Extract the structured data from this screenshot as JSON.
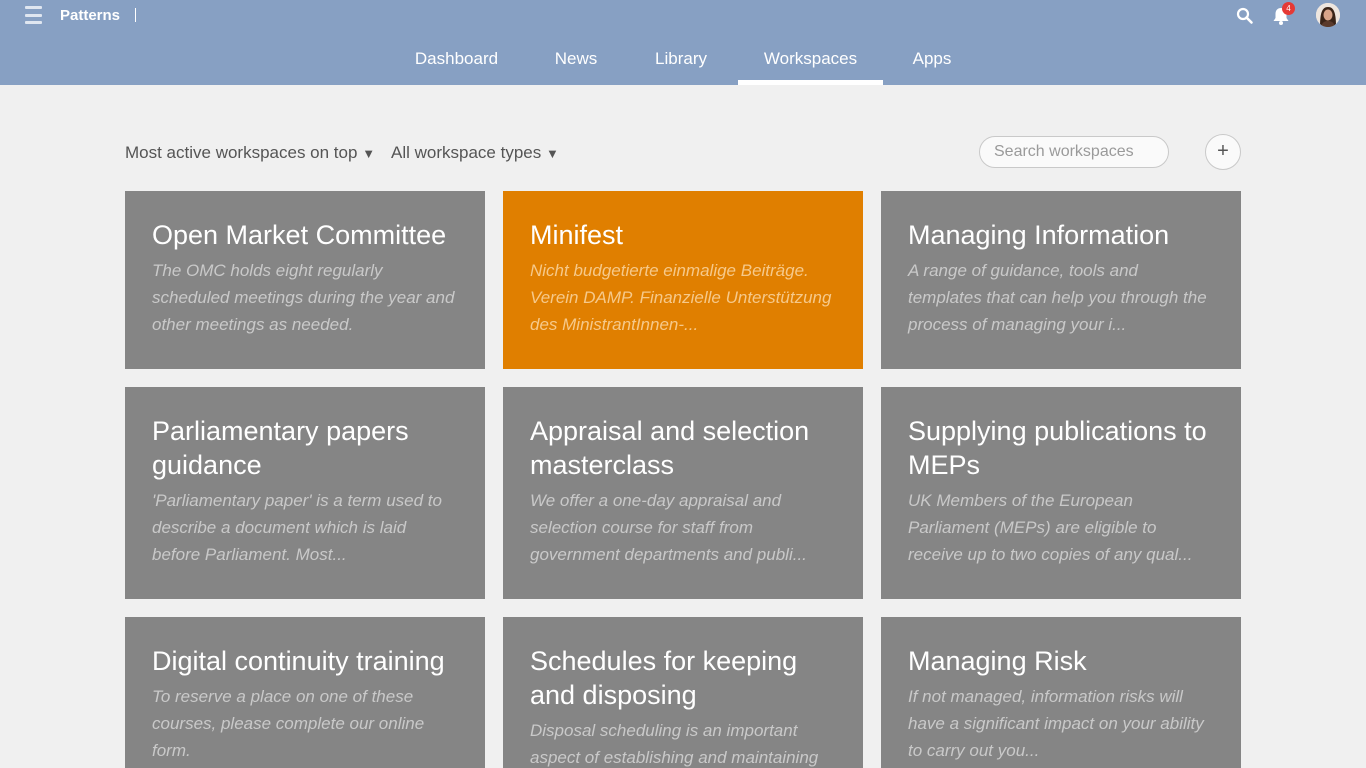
{
  "header": {
    "brand": "Patterns",
    "notification_count": "4",
    "icons": {
      "menu": "hamburger-icon",
      "search": "search-icon",
      "notifications": "bell-icon",
      "avatar": "user-avatar"
    },
    "colors": {
      "topbar": "#87a0c3",
      "badge": "#e53935"
    }
  },
  "nav": {
    "items": [
      {
        "label": "Dashboard"
      },
      {
        "label": "News"
      },
      {
        "label": "Library"
      },
      {
        "label": "Workspaces",
        "active": true
      },
      {
        "label": "Apps"
      }
    ]
  },
  "filters": {
    "sort_label": "Most active workspaces on top",
    "type_label": "All workspace types",
    "caret": "▼",
    "search_placeholder": "Search workspaces",
    "add_label": "+"
  },
  "cards": [
    {
      "title": "Open Market Committee",
      "desc": "The OMC holds eight regularly scheduled meetings during the year and other meetings as needed."
    },
    {
      "title": "Minifest",
      "desc": "Nicht budgetierte einmalige Beiträge. Verein DAMP. Finanzielle Unterstützung des MinistrantInnen-...",
      "color": "#e07f00"
    },
    {
      "title": "Managing Information",
      "desc": "A range of guidance, tools and templates that can help you through the process of managing your i..."
    },
    {
      "title": "Parliamentary papers guidance",
      "desc": "'Parliamentary paper' is a term used to describe a document which is laid before Parliament. Most..."
    },
    {
      "title": "Appraisal and selection masterclass",
      "desc": "We offer a one-day appraisal and selection course for staff from government departments and publi..."
    },
    {
      "title": "Supplying publications to MEPs",
      "desc": "UK Members of the European Parliament (MEPs) are eligible to receive up to two copies of any qual..."
    },
    {
      "title": "Digital continuity training",
      "desc": "To reserve a place on one of these courses, please complete our online form."
    },
    {
      "title": "Schedules for keeping and disposing",
      "desc": "Disposal scheduling is an important aspect of establishing and maintaining"
    },
    {
      "title": "Managing Risk",
      "desc": "If not managed, information risks will have a significant impact on your ability to carry out you..."
    }
  ]
}
